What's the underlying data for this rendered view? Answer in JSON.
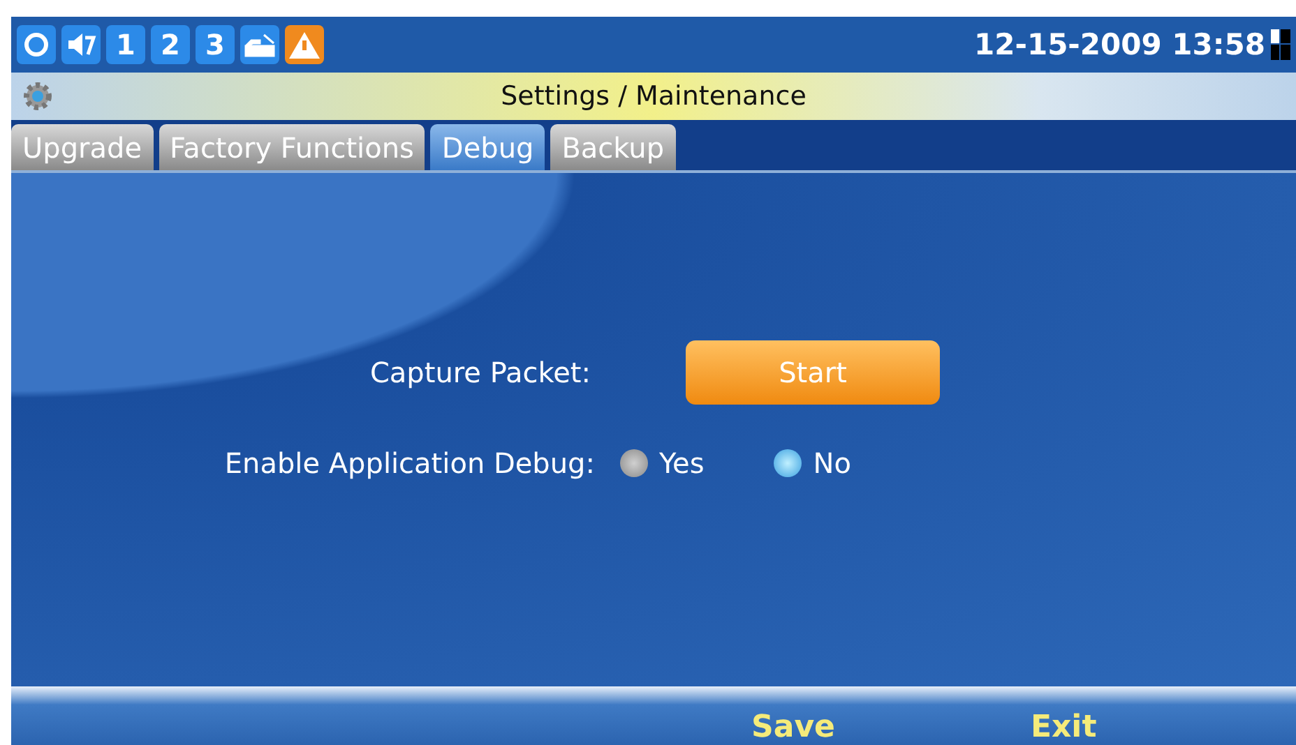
{
  "status_bar": {
    "line_numbers": [
      "1",
      "2",
      "3"
    ],
    "datetime": "12-15-2009 13:58"
  },
  "window": {
    "title": "Settings / Maintenance"
  },
  "tabs": [
    {
      "label": "Upgrade",
      "selected": false
    },
    {
      "label": "Factory Functions",
      "selected": false
    },
    {
      "label": "Debug",
      "selected": true
    },
    {
      "label": "Backup",
      "selected": false
    }
  ],
  "capture_packet": {
    "label": "Capture Packet:",
    "button": "Start"
  },
  "application_debug": {
    "label": "Enable Application Debug:",
    "options": [
      {
        "label": "Yes",
        "selected": false
      },
      {
        "label": "No",
        "selected": true
      }
    ]
  },
  "softkeys": [
    "Save",
    "Exit"
  ]
}
